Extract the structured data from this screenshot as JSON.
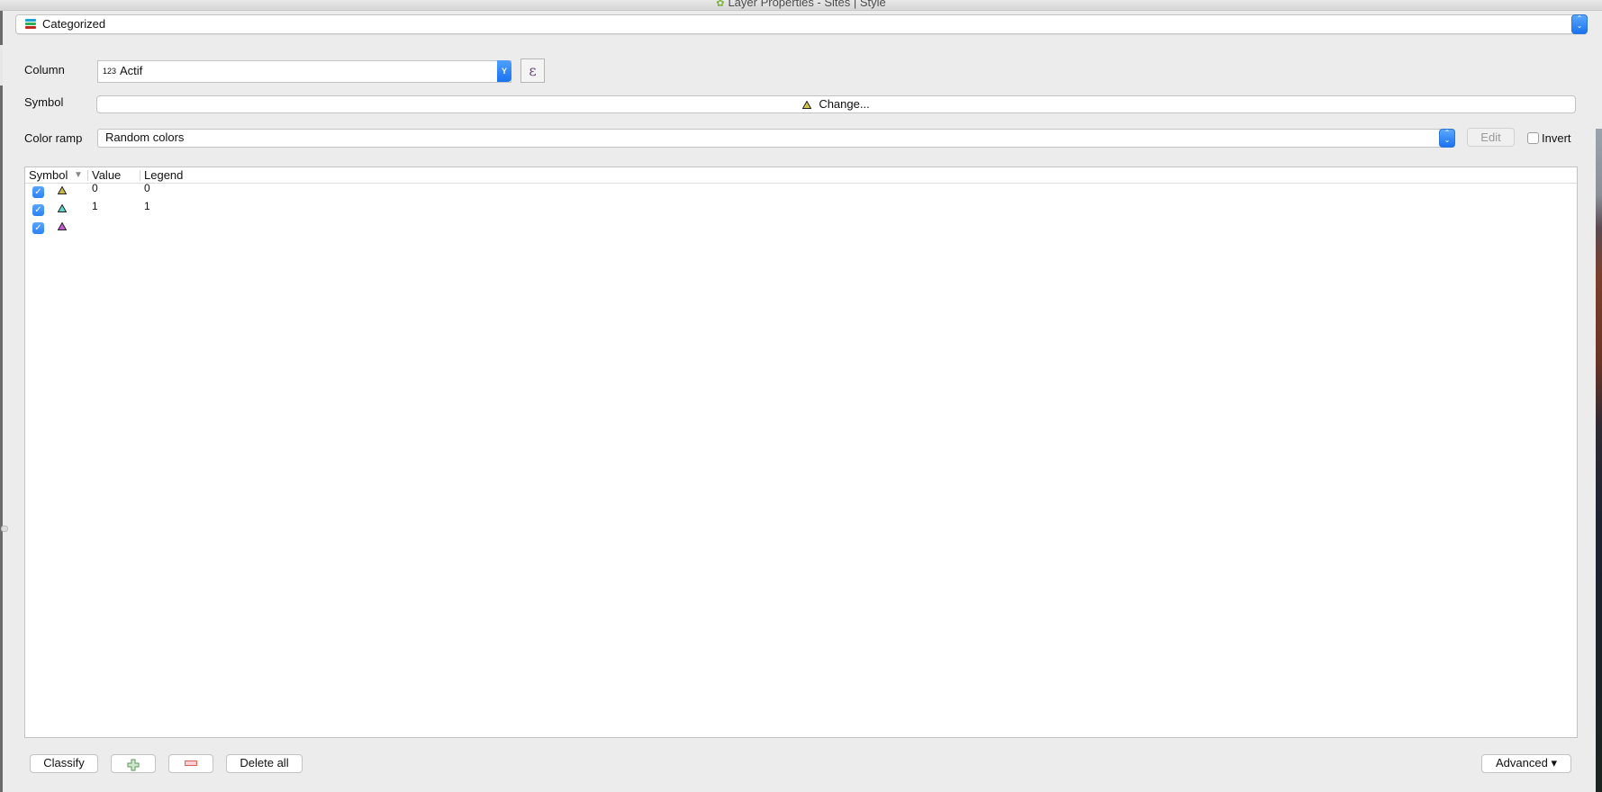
{
  "window": {
    "title": "Layer Properties - Sites | Style",
    "icon": "qgis-icon"
  },
  "renderer": {
    "selected": "Categorized",
    "icon": "categorized-renderer-icon",
    "icon_colors": [
      "#1aa3d4",
      "#2dae5a",
      "#c0281f"
    ]
  },
  "form": {
    "column_label": "Column",
    "column_type_badge": "123",
    "column_value": "Actif",
    "expression_button": "ε",
    "symbol_label": "Symbol",
    "symbol_button": "Change...",
    "symbol_color": "#d4c64a",
    "color_ramp_label": "Color ramp",
    "color_ramp_value": "Random colors",
    "edit_button": "Edit",
    "invert_label": "Invert",
    "invert_checked": false
  },
  "table": {
    "columns": [
      "Symbol",
      "Value",
      "Legend"
    ],
    "sort_indicator": "▼",
    "rows": [
      {
        "checked": true,
        "symbol_color": "#c9bb4a",
        "value": "0",
        "legend": "0"
      },
      {
        "checked": true,
        "symbol_color": "#5fd6c9",
        "value": "1",
        "legend": "1"
      },
      {
        "checked": true,
        "symbol_color": "#c35ad0",
        "value": "",
        "legend": ""
      }
    ]
  },
  "buttons": {
    "classify": "Classify",
    "add_icon": "plus-icon",
    "remove_icon": "minus-icon",
    "delete_all": "Delete all",
    "advanced": "Advanced ▾"
  },
  "colors": {
    "accent": "#1a72f0",
    "add": "#5a9a5a",
    "remove": "#e06060"
  }
}
